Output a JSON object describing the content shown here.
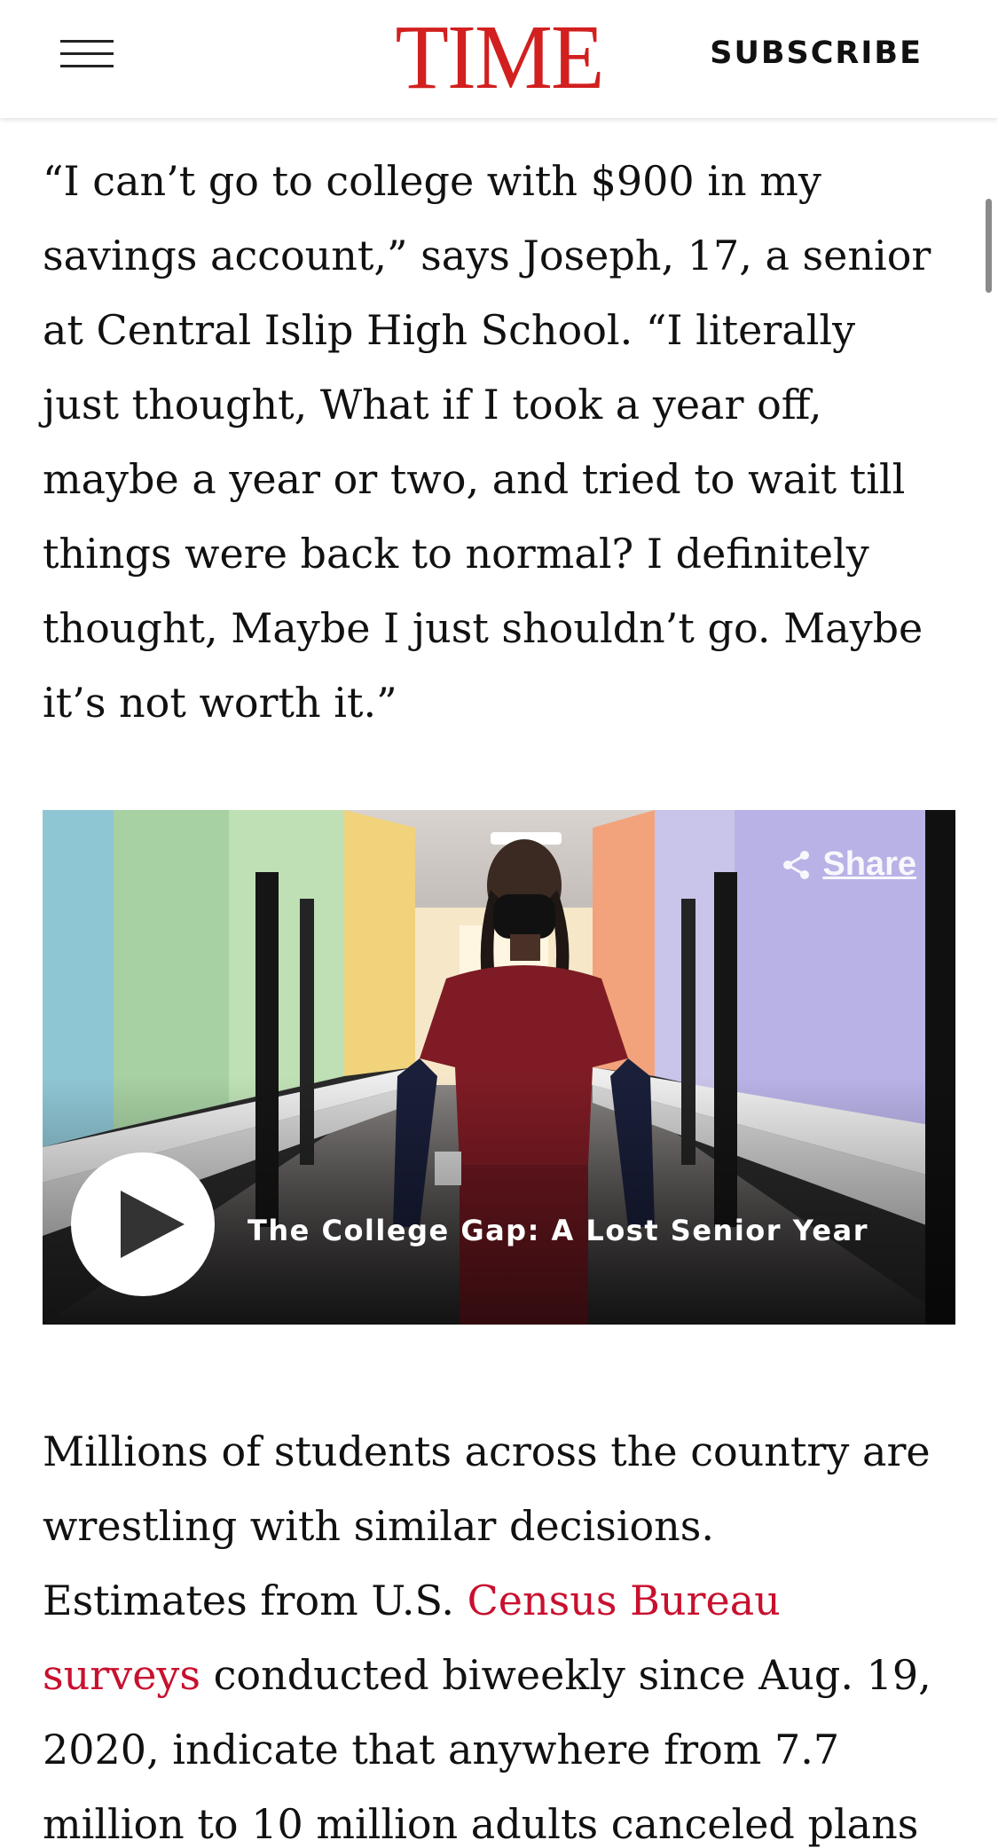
{
  "header": {
    "logo": "TIME",
    "subscribe_label": "SUBSCRIBE",
    "menu_icon": "hamburger-menu-icon",
    "brand_color": "#d21f1f"
  },
  "article": {
    "para1_lines": [
      "“I can’t go to college with $900 in my",
      "savings account,” says Joseph, 17, a senior",
      "at Central Islip High School. “I literally",
      "just thought, What if I took a year off,",
      "maybe a year or two, and tried to wait till",
      "things were back to normal? I definitely",
      "thought, Maybe I just shouldn’t go. Maybe",
      "it’s not worth it.”"
    ],
    "para2": {
      "line1": "Millions of students across the country are",
      "line2": "wrestling with similar decisions.",
      "line3_text": "Estimates from U.S. ",
      "link_part1": "Census Bureau",
      "link_part2": "surveys",
      "line4_rest": " conducted biweekly since Aug. 19,",
      "line5": "2020, indicate that anywhere from 7.7",
      "line6": "million to 10 million adults canceled plans"
    },
    "link_color": "#c8102e"
  },
  "video": {
    "title": "The College Gap: A Lost Senior Year",
    "share_label": "Share",
    "share_icon": "share-icon",
    "play_icon": "play-icon"
  }
}
